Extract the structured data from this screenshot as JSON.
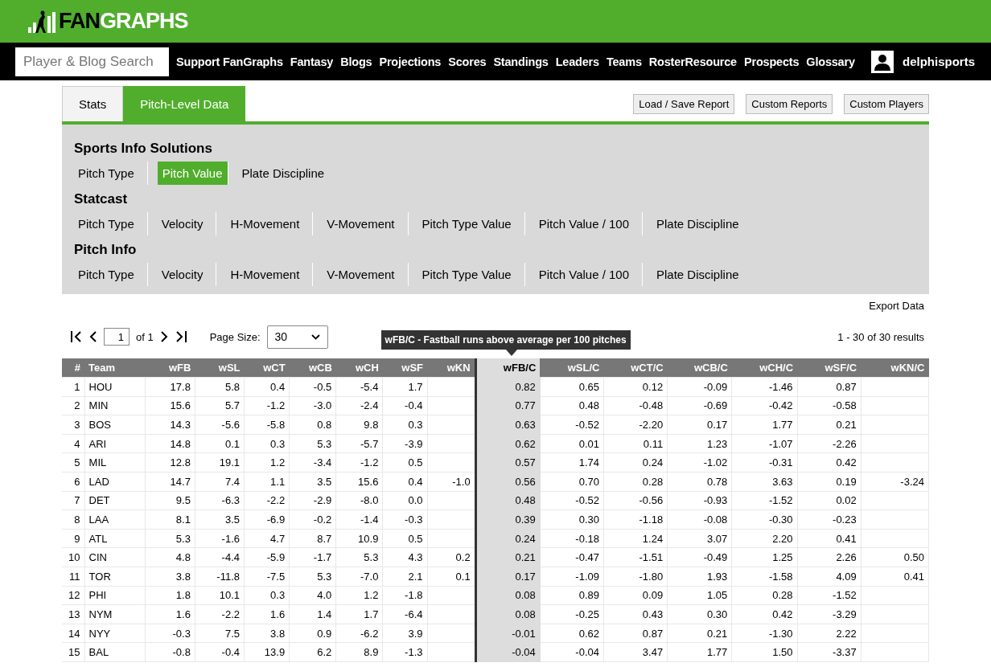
{
  "logo": {
    "dark_part": "FAN",
    "light_part": "GRAPHS"
  },
  "search": {
    "placeholder": "Player & Blog Search"
  },
  "nav": [
    "Support FanGraphs",
    "Fantasy",
    "Blogs",
    "Projections",
    "Scores",
    "Standings",
    "Leaders",
    "Teams",
    "RosterResource",
    "Prospects",
    "Glossary"
  ],
  "user": {
    "name": "delphisports"
  },
  "tabs": [
    {
      "label": "Stats",
      "selected": false
    },
    {
      "label": "Pitch-Level Data",
      "selected": true
    }
  ],
  "report_buttons": [
    "Load / Save Report",
    "Custom Reports",
    "Custom Players"
  ],
  "sections": [
    {
      "title": "Sports Info Solutions",
      "items": [
        {
          "label": "Pitch Type",
          "selected": false
        },
        {
          "label": "Pitch Value",
          "selected": true
        },
        {
          "label": "Plate Discipline",
          "selected": false
        }
      ]
    },
    {
      "title": "Statcast",
      "items": [
        {
          "label": "Pitch Type",
          "selected": false
        },
        {
          "label": "Velocity",
          "selected": false
        },
        {
          "label": "H-Movement",
          "selected": false
        },
        {
          "label": "V-Movement",
          "selected": false
        },
        {
          "label": "Pitch Type Value",
          "selected": false
        },
        {
          "label": "Pitch Value / 100",
          "selected": false
        },
        {
          "label": "Plate Discipline",
          "selected": false
        }
      ]
    },
    {
      "title": "Pitch Info",
      "items": [
        {
          "label": "Pitch Type",
          "selected": false
        },
        {
          "label": "Velocity",
          "selected": false
        },
        {
          "label": "H-Movement",
          "selected": false
        },
        {
          "label": "V-Movement",
          "selected": false
        },
        {
          "label": "Pitch Type Value",
          "selected": false
        },
        {
          "label": "Pitch Value / 100",
          "selected": false
        },
        {
          "label": "Plate Discipline",
          "selected": false
        }
      ]
    }
  ],
  "export_link": "Export Data",
  "pager": {
    "page": "1",
    "of": "of 1",
    "page_size_label": "Page Size:",
    "page_size": "30",
    "results": "1 - 30 of 30 results"
  },
  "tooltip": "wFB/C - Fastball runs above average per 100 pitches",
  "table": {
    "columns": [
      {
        "label": "#",
        "selected": false
      },
      {
        "label": "Team",
        "selected": false
      },
      {
        "label": "wFB",
        "selected": false
      },
      {
        "label": "wSL",
        "selected": false
      },
      {
        "label": "wCT",
        "selected": false
      },
      {
        "label": "wCB",
        "selected": false
      },
      {
        "label": "wCH",
        "selected": false
      },
      {
        "label": "wSF",
        "selected": false
      },
      {
        "label": "wKN",
        "selected": false
      },
      {
        "label": "wFB/C",
        "selected": true
      },
      {
        "label": "wSL/C",
        "selected": false
      },
      {
        "label": "wCT/C",
        "selected": false
      },
      {
        "label": "wCB/C",
        "selected": false
      },
      {
        "label": "wCH/C",
        "selected": false
      },
      {
        "label": "wSF/C",
        "selected": false
      },
      {
        "label": "wKN/C",
        "selected": false
      }
    ],
    "rows": [
      [
        "1",
        "HOU",
        "17.8",
        "5.8",
        "0.4",
        "-0.5",
        "-5.4",
        "1.7",
        null,
        "0.82",
        "0.65",
        "0.12",
        "-0.09",
        "-1.46",
        "0.87",
        null
      ],
      [
        "2",
        "MIN",
        "15.6",
        "5.7",
        "-1.2",
        "-3.0",
        "-2.4",
        "-0.4",
        null,
        "0.77",
        "0.48",
        "-0.48",
        "-0.69",
        "-0.42",
        "-0.58",
        null
      ],
      [
        "3",
        "BOS",
        "14.3",
        "-5.6",
        "-5.8",
        "0.8",
        "9.8",
        "0.3",
        null,
        "0.63",
        "-0.52",
        "-2.20",
        "0.17",
        "1.77",
        "0.21",
        null
      ],
      [
        "4",
        "ARI",
        "14.8",
        "0.1",
        "0.3",
        "5.3",
        "-5.7",
        "-3.9",
        null,
        "0.62",
        "0.01",
        "0.11",
        "1.23",
        "-1.07",
        "-2.26",
        null
      ],
      [
        "5",
        "MIL",
        "12.8",
        "19.1",
        "1.2",
        "-3.4",
        "-1.2",
        "0.5",
        null,
        "0.57",
        "1.74",
        "0.24",
        "-1.02",
        "-0.31",
        "0.42",
        null
      ],
      [
        "6",
        "LAD",
        "14.7",
        "7.4",
        "1.1",
        "3.5",
        "15.6",
        "0.4",
        "-1.0",
        "0.56",
        "0.70",
        "0.28",
        "0.78",
        "3.63",
        "0.19",
        "-3.24"
      ],
      [
        "7",
        "DET",
        "9.5",
        "-6.3",
        "-2.2",
        "-2.9",
        "-8.0",
        "0.0",
        null,
        "0.48",
        "-0.52",
        "-0.56",
        "-0.93",
        "-1.52",
        "0.02",
        null
      ],
      [
        "8",
        "LAA",
        "8.1",
        "3.5",
        "-6.9",
        "-0.2",
        "-1.4",
        "-0.3",
        null,
        "0.39",
        "0.30",
        "-1.18",
        "-0.08",
        "-0.30",
        "-0.23",
        null
      ],
      [
        "9",
        "ATL",
        "5.3",
        "-1.6",
        "4.7",
        "8.7",
        "10.9",
        "0.5",
        null,
        "0.24",
        "-0.18",
        "1.24",
        "3.07",
        "2.20",
        "0.41",
        null
      ],
      [
        "10",
        "CIN",
        "4.8",
        "-4.4",
        "-5.9",
        "-1.7",
        "5.3",
        "4.3",
        "0.2",
        "0.21",
        "-0.47",
        "-1.51",
        "-0.49",
        "1.25",
        "2.26",
        "0.50"
      ],
      [
        "11",
        "TOR",
        "3.8",
        "-11.8",
        "-7.5",
        "5.3",
        "-7.0",
        "2.1",
        "0.1",
        "0.17",
        "-1.09",
        "-1.80",
        "1.93",
        "-1.58",
        "4.09",
        "0.41"
      ],
      [
        "12",
        "PHI",
        "1.8",
        "10.1",
        "0.3",
        "4.0",
        "1.2",
        "-1.8",
        null,
        "0.08",
        "0.89",
        "0.09",
        "1.05",
        "0.28",
        "-1.52",
        null
      ],
      [
        "13",
        "NYM",
        "1.6",
        "-2.2",
        "1.6",
        "1.4",
        "1.7",
        "-6.4",
        null,
        "0.08",
        "-0.25",
        "0.43",
        "0.30",
        "0.42",
        "-3.29",
        null
      ],
      [
        "14",
        "NYY",
        "-0.3",
        "7.5",
        "3.8",
        "0.9",
        "-6.2",
        "3.9",
        null,
        "-0.01",
        "0.62",
        "0.87",
        "0.21",
        "-1.30",
        "2.22",
        null
      ],
      [
        "15",
        "BAL",
        "-0.8",
        "-0.4",
        "13.9",
        "6.2",
        "8.9",
        "-1.3",
        null,
        "-0.04",
        "-0.04",
        "3.47",
        "1.77",
        "1.50",
        "-3.37",
        null
      ]
    ]
  }
}
